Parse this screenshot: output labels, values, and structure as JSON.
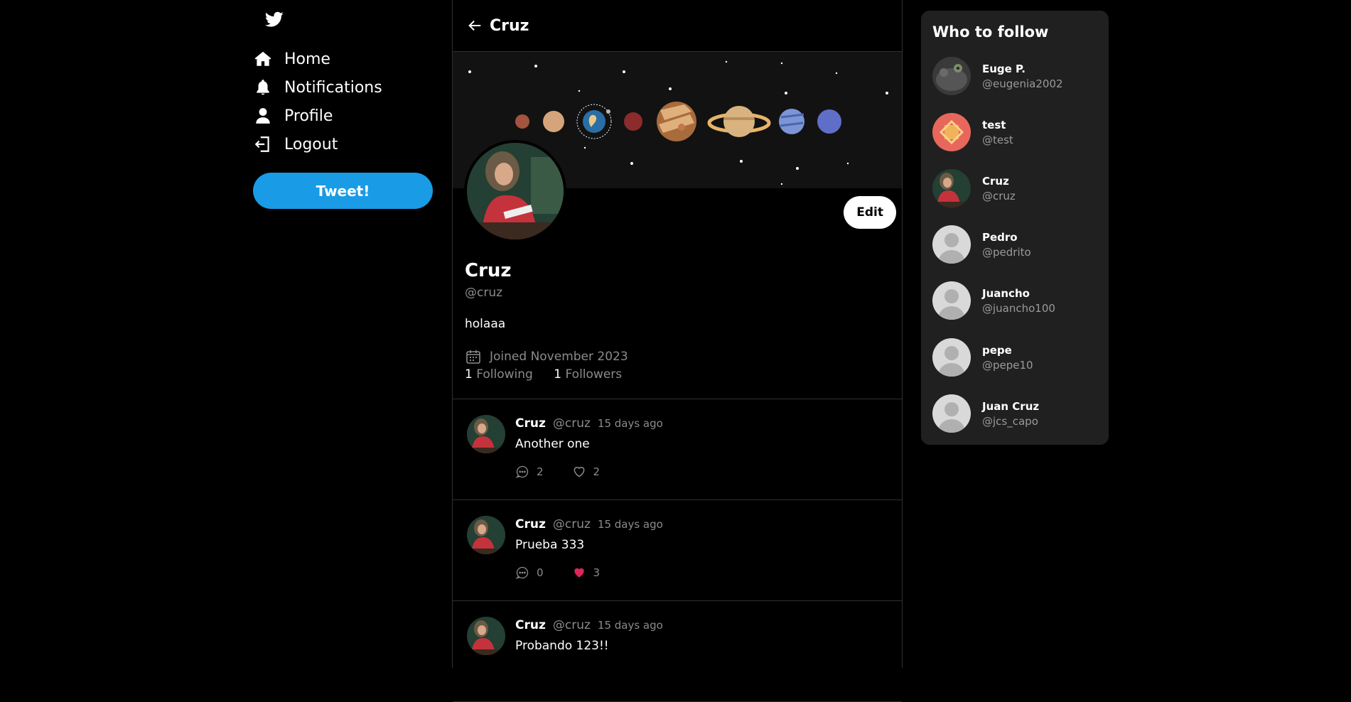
{
  "nav": {
    "items": [
      {
        "label": "Home",
        "icon": "home-icon"
      },
      {
        "label": "Notifications",
        "icon": "bell-icon"
      },
      {
        "label": "Profile",
        "icon": "user-icon"
      },
      {
        "label": "Logout",
        "icon": "logout-icon"
      }
    ],
    "tweet_button": "Tweet!"
  },
  "header": {
    "title": "Cruz"
  },
  "profile": {
    "name": "Cruz",
    "handle": "@cruz",
    "bio": "holaaa",
    "joined": "Joined November 2023",
    "following_count": "1",
    "following_label": "Following",
    "followers_count": "1",
    "followers_label": "Followers",
    "edit_label": "Edit"
  },
  "tweets": [
    {
      "name": "Cruz",
      "handle": "@cruz",
      "time": "15 days ago",
      "text": "Another one",
      "replies": "2",
      "likes": "2",
      "liked": false
    },
    {
      "name": "Cruz",
      "handle": "@cruz",
      "time": "15 days ago",
      "text": "Prueba 333",
      "replies": "0",
      "likes": "3",
      "liked": true
    },
    {
      "name": "Cruz",
      "handle": "@cruz",
      "time": "15 days ago",
      "text": "Probando 123!!",
      "replies": "",
      "likes": "",
      "liked": false
    }
  ],
  "who_to_follow": {
    "title": "Who to follow",
    "users": [
      {
        "name": "Euge P.",
        "handle": "@eugenia2002"
      },
      {
        "name": "test",
        "handle": "@test"
      },
      {
        "name": "Cruz",
        "handle": "@cruz"
      },
      {
        "name": "Pedro",
        "handle": "@pedrito"
      },
      {
        "name": "Juancho",
        "handle": "@juancho100"
      },
      {
        "name": "pepe",
        "handle": "@pepe10"
      },
      {
        "name": "Juan Cruz",
        "handle": "@jcs_capo"
      }
    ]
  },
  "colors": {
    "accent": "#1a9be6",
    "like": "#e0245e",
    "muted": "#8b8b8b"
  }
}
